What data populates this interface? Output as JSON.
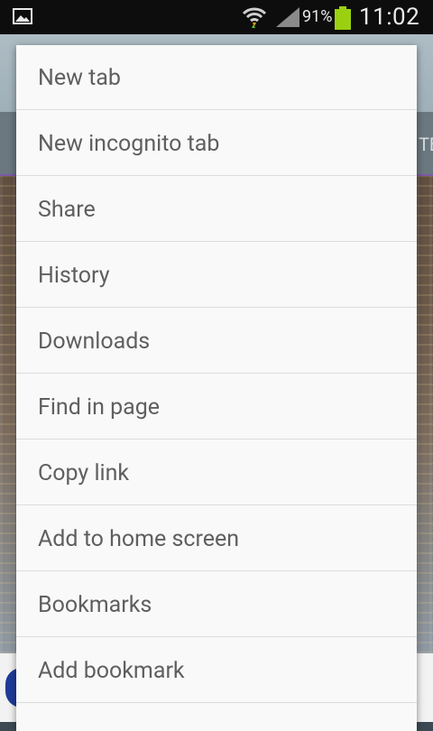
{
  "status_bar": {
    "battery_percent": "91%",
    "time": "11:02",
    "icons": [
      "image-icon",
      "wifi-icon",
      "signal-icon",
      "battery-icon"
    ]
  },
  "background": {
    "partial_text": "TE"
  },
  "menu": {
    "items": [
      {
        "label": "New tab"
      },
      {
        "label": "New incognito tab"
      },
      {
        "label": "Share"
      },
      {
        "label": "History"
      },
      {
        "label": "Downloads"
      },
      {
        "label": "Find in page"
      },
      {
        "label": "Copy link"
      },
      {
        "label": "Add to home screen"
      },
      {
        "label": "Bookmarks"
      },
      {
        "label": "Add bookmark"
      }
    ]
  }
}
